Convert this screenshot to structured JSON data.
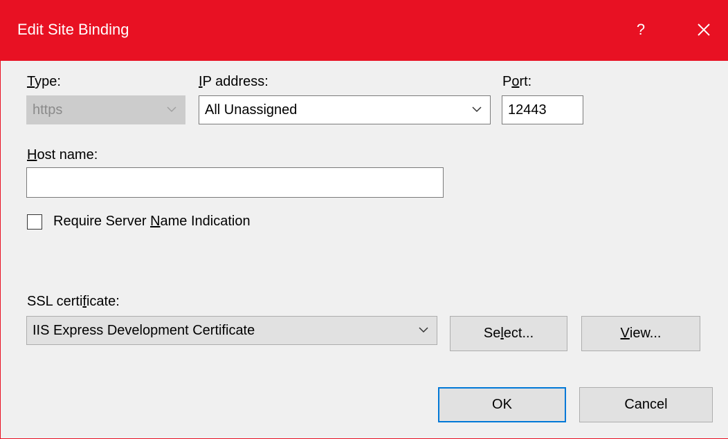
{
  "window": {
    "title": "Edit Site Binding",
    "help_glyph": "?",
    "close_icon": "close-icon",
    "accent_color": "#e81123"
  },
  "type": {
    "label_hotkey": "T",
    "label_rest": "ype:",
    "value": "https"
  },
  "ip_address": {
    "label_hotkey": "I",
    "label_rest": "P address:",
    "value": "All Unassigned"
  },
  "port": {
    "label_pre": "P",
    "label_hotkey": "o",
    "label_rest": "rt:",
    "value": "12443"
  },
  "host_name": {
    "label_hotkey": "H",
    "label_rest": "ost name:",
    "value": ""
  },
  "sni": {
    "label_pre": "Require Server ",
    "label_hotkey": "N",
    "label_rest": "ame Indication",
    "checked": false
  },
  "ssl_certificate": {
    "label_pre": "SSL certi",
    "label_hotkey": "f",
    "label_rest": "icate:",
    "value": "IIS Express Development Certificate"
  },
  "buttons": {
    "select_pre": "Se",
    "select_hotkey": "l",
    "select_rest": "ect...",
    "view_hotkey": "V",
    "view_rest": "iew...",
    "ok": "OK",
    "cancel": "Cancel"
  }
}
